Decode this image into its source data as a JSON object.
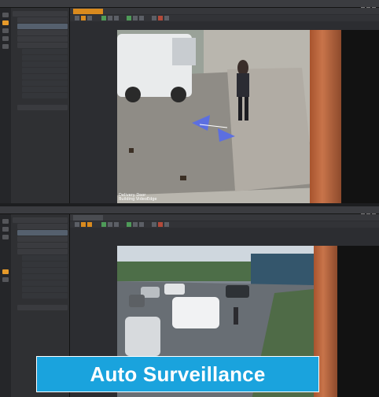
{
  "banner": {
    "title": "Auto Surveillance"
  },
  "screens": [
    {
      "camera_overlay": "Delivery Door\nBuilding VideoEdge"
    },
    {
      "camera_overlay": ""
    }
  ],
  "colors": {
    "accent": "#d98a1e",
    "banner": "#1aa3dd",
    "arrow": "#5c6fe0"
  }
}
